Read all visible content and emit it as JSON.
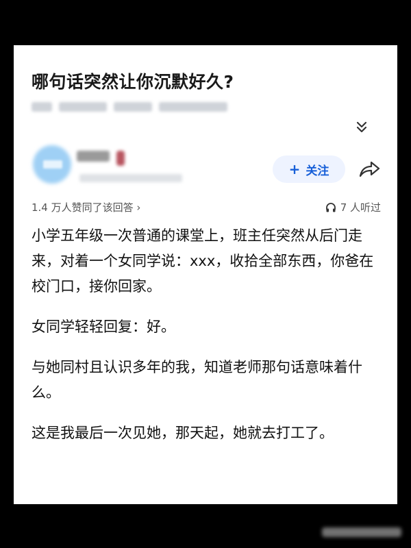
{
  "question": {
    "title": "哪句话突然让你沉默好久?"
  },
  "author": {
    "follow_label": "关注",
    "follow_plus": "+"
  },
  "meta": {
    "likes_text": "1.4 万人赞同了该回答 ›",
    "listen_text": "7 人听过"
  },
  "answer": {
    "paragraphs": [
      "小学五年级一次普通的课堂上，班主任突然从后门走来，对着一个女同学说：xxx，收拾全部东西，你爸在校门口，接你回家。",
      "女同学轻轻回复：好。",
      "与她同村且认识多年的我，知道老师那句话意味着什么。",
      "这是我最后一次见她，那天起，她就去打工了。"
    ]
  },
  "colors": {
    "accent": "#175fd8",
    "follow_bg": "#eef3ff",
    "text": "#111111",
    "meta_text": "#555555",
    "page_bg": "#000000",
    "card_bg": "#ffffff"
  },
  "icons": {
    "expand": "double-chevron-down-icon",
    "share": "share-arrow-icon",
    "headphones": "headphones-icon"
  }
}
